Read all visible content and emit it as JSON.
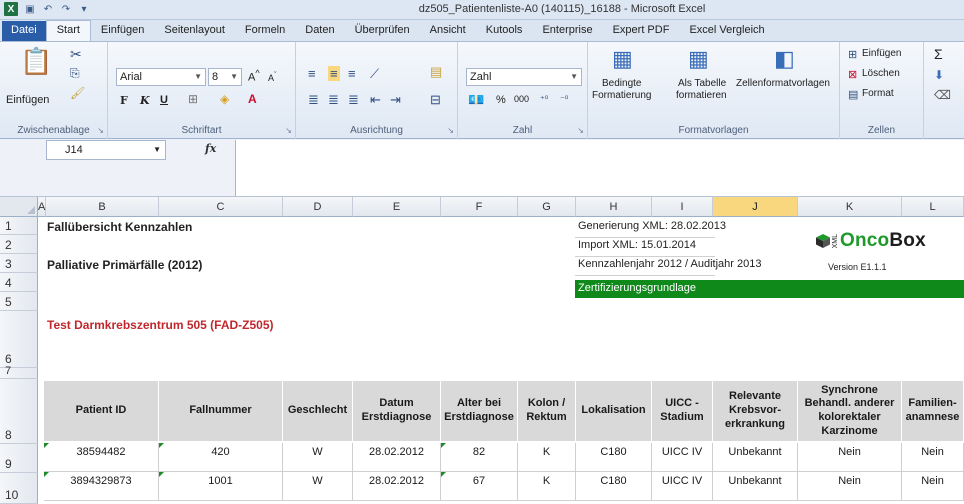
{
  "window": {
    "app_logo": "excel-icon",
    "title": "dz505_Patientenliste-A0 (140115)_16188 - Microsoft Excel"
  },
  "tabs": [
    "Datei",
    "Start",
    "Einfügen",
    "Seitenlayout",
    "Formeln",
    "Daten",
    "Überprüfen",
    "Ansicht",
    "Kutools",
    "Enterprise",
    "Expert PDF",
    "Excel Vergleich"
  ],
  "ribbon": {
    "clipboard": {
      "paste": "Einfügen",
      "label": "Zwischenablage"
    },
    "font": {
      "name": "Arial",
      "size": "8",
      "bold": "F",
      "italic": "K",
      "underline": "U",
      "label": "Schriftart"
    },
    "alignment": {
      "label": "Ausrichtung"
    },
    "number": {
      "format": "Zahl",
      "percent": "%",
      "thousands": "000",
      "label": "Zahl"
    },
    "styles": {
      "conditional": "Bedingte",
      "conditional2": "Formatierung",
      "as_table": "Als Tabelle",
      "as_table2": "formatieren",
      "cell_styles": "Zellenformatvorlagen",
      "label": "Formatvorlagen"
    },
    "cells": {
      "insert": "Einfügen",
      "delete": "Löschen",
      "format": "Format",
      "label": "Zellen"
    }
  },
  "formula_bar": {
    "name_box": "J14",
    "fx": "fx",
    "formula": ""
  },
  "columns": [
    "A",
    "B",
    "C",
    "D",
    "E",
    "F",
    "G",
    "H",
    "I",
    "J",
    "K",
    "L"
  ],
  "selected_column": "J",
  "rows": [
    "1",
    "2",
    "3",
    "4",
    "5",
    "6",
    "7",
    "8",
    "9",
    "10"
  ],
  "sheet": {
    "title": "Fallübersicht Kennzahlen",
    "subtitle": "Palliative Primärfälle (2012)",
    "center": "Test Darmkrebszentrum 505 (FAD-Z505)",
    "info": [
      "Generierung XML: 28.02.2013",
      "Import XML: 15.01.2014",
      "Kennzahlenjahr 2012 / Auditjahr 2013"
    ],
    "green_bar": "Zertifizierungsgrundlage",
    "logo_prefix": "XML",
    "logo_onco": "Onco",
    "logo_box": "Box",
    "logo_version": "Version E1.1.1"
  },
  "table": {
    "headers": [
      "Patient ID",
      "Fallnummer",
      "Geschlecht",
      "Datum Erstdiagnose",
      "Alter bei Erstdiagnose",
      "Kolon / Rektum",
      "Lokalisation",
      "UICC - Stadium",
      "Relevante Krebsvor-erkrankung",
      "Synchrone Behandl. anderer kolorektaler Karzinome",
      "Familien-anamnese"
    ],
    "rows": [
      [
        "38594482",
        "420",
        "W",
        "28.02.2012",
        "82",
        "K",
        "C180",
        "UICC IV",
        "Unbekannt",
        "Nein",
        "Nein"
      ],
      [
        "3894329873",
        "1001",
        "W",
        "28.02.2012",
        "67",
        "K",
        "C180",
        "UICC IV",
        "Unbekannt",
        "Nein",
        "Nein"
      ]
    ]
  },
  "colors": {
    "accent_green": "#0f8a1a",
    "header_gray": "#d9d9d9",
    "center_red": "#c0282d",
    "selected_col": "#f8d77f"
  }
}
